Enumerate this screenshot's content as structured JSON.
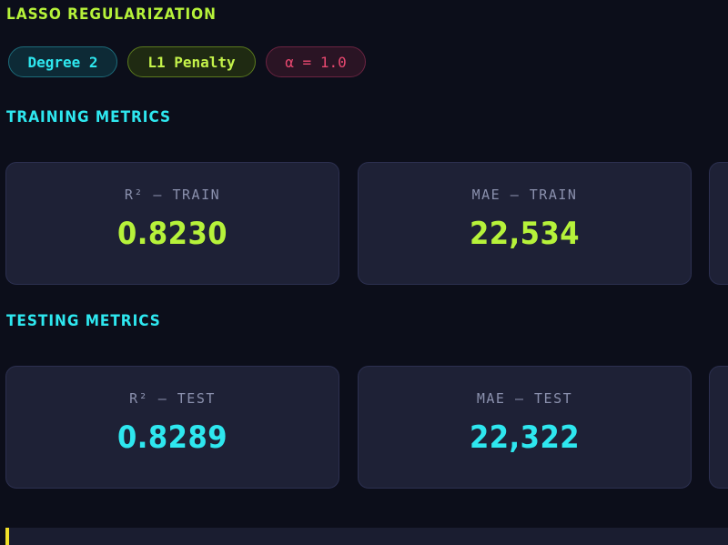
{
  "header": {
    "title": "LASSO REGULARIZATION"
  },
  "badges": {
    "degree": "Degree 2",
    "penalty": "L1 Penalty",
    "alpha": "α = 1.0"
  },
  "training": {
    "title": "TRAINING METRICS",
    "r2_label": "R² — TRAIN",
    "r2_value": "0.8230",
    "mae_label": "MAE — TRAIN",
    "mae_value": "22,534"
  },
  "testing": {
    "title": "TESTING METRICS",
    "r2_label": "R² — TEST",
    "r2_value": "0.8289",
    "mae_label": "MAE — TEST",
    "mae_value": "22,322"
  },
  "colors": {
    "background": "#0c0e1a",
    "card": "#1e2136",
    "accent_green": "#b6f23a",
    "accent_cyan": "#2ee7ef",
    "accent_pink": "#e8486f",
    "accent_yellow": "#f0e02a"
  }
}
